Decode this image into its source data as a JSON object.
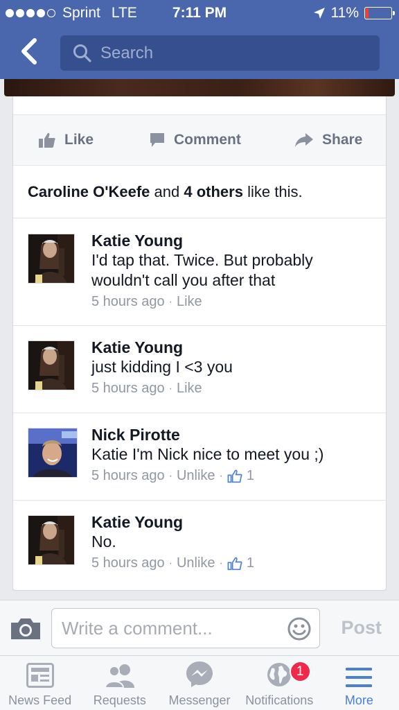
{
  "status_bar": {
    "carrier": "Sprint",
    "network": "LTE",
    "time": "7:11 PM",
    "battery": "11%",
    "battery_level": 0.11
  },
  "nav": {
    "search_placeholder": "Search"
  },
  "post_actions": {
    "like": "Like",
    "comment": "Comment",
    "share": "Share"
  },
  "likes": {
    "first_name": "Caroline O'Keefe",
    "and": "and",
    "others": "4 others",
    "suffix": "like this."
  },
  "comments": [
    {
      "author": "Katie Young",
      "text": "I'd tap that. Twice. But probably wouldn't call you after that",
      "time": "5 hours ago",
      "action": "Like",
      "like_count": ""
    },
    {
      "author": "Katie Young",
      "text": "just kidding I <3 you",
      "time": "5 hours ago",
      "action": "Like",
      "like_count": ""
    },
    {
      "author": "Nick Pirotte",
      "text": "Katie I'm Nick nice to meet you ;)",
      "time": "5 hours ago",
      "action": "Unlike",
      "like_count": "1"
    },
    {
      "author": "Katie Young",
      "text": "No.",
      "time": "5 hours ago",
      "action": "Unlike",
      "like_count": "1"
    }
  ],
  "composer": {
    "placeholder": "Write a comment...",
    "post_label": "Post"
  },
  "tab_bar": {
    "tabs": [
      {
        "label": "News Feed",
        "icon": "news-feed-icon"
      },
      {
        "label": "Requests",
        "icon": "friend-requests-icon"
      },
      {
        "label": "Messenger",
        "icon": "messenger-icon"
      },
      {
        "label": "Notifications",
        "icon": "globe-icon",
        "badge": "1"
      },
      {
        "label": "More",
        "icon": "hamburger-menu-icon"
      }
    ],
    "active_tab": "More"
  },
  "colors": {
    "brand_blue": "#4a67ad",
    "link_blue": "#4a7fd4",
    "badge_red": "#f02849"
  }
}
